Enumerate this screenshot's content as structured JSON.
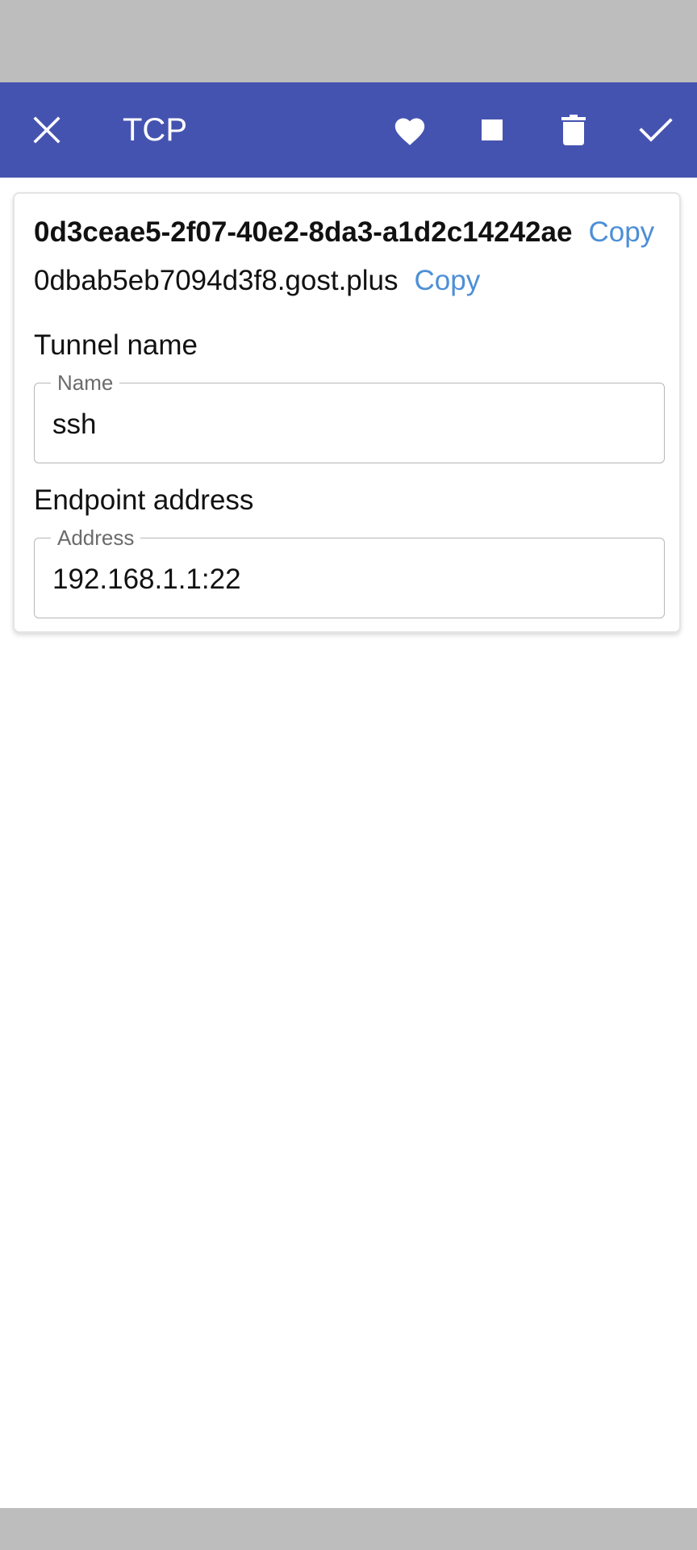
{
  "app_bar": {
    "title": "TCP",
    "background": "#4553b0",
    "icons": {
      "close": "close-icon",
      "favorite": "heart-icon",
      "stop": "stop-icon",
      "delete": "trash-icon",
      "save": "check-icon"
    }
  },
  "tunnel": {
    "id": "0d3ceae5-2f07-40e2-8da3-a1d2c14242ae",
    "host": "0dbab5eb7094d3f8.gost.plus",
    "copy_label": "Copy",
    "copy_color": "#4d8fd6"
  },
  "name_section": {
    "label": "Tunnel name",
    "field_label": "Name",
    "value": "ssh"
  },
  "endpoint_section": {
    "label": "Endpoint address",
    "field_label": "Address",
    "value": "192.168.1.1:22"
  }
}
